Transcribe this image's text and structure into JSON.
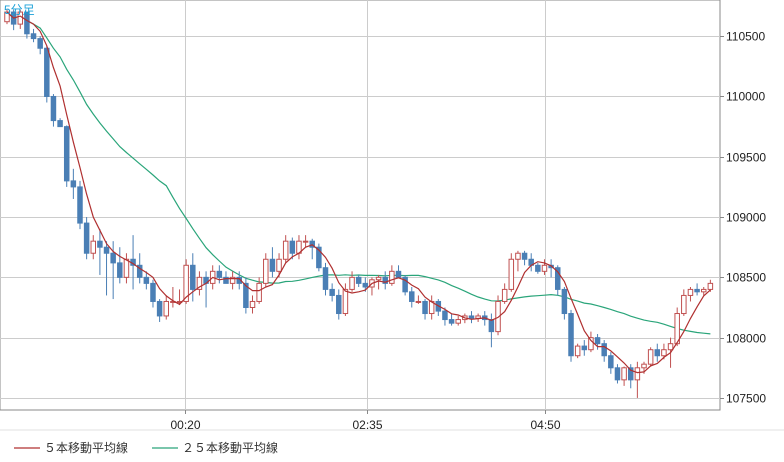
{
  "chart_data": {
    "type": "candlestick",
    "timeframe": "5分足",
    "x_ticks": [
      "00:20",
      "02:35",
      "04:50"
    ],
    "y_ticks": [
      107500,
      108000,
      108500,
      109000,
      109500,
      110000,
      110500
    ],
    "ylim": [
      107400,
      110800
    ],
    "grid": true,
    "legend_position": "bottom-left",
    "colors": {
      "up": "#ffffff",
      "up_border": "#c05050",
      "down": "#4a7fb5",
      "ma5": "#b03030",
      "ma25": "#2aa57a",
      "grid": "#cccccc",
      "timeframe_label": "#1aa0d8"
    },
    "series": [
      {
        "name": "５本移動平均線",
        "color": "#b03030"
      },
      {
        "name": "２５本移動平均線",
        "color": "#2aa57a"
      }
    ],
    "candles": [
      [
        110620,
        110720,
        110600,
        110700
      ],
      [
        110700,
        110720,
        110550,
        110600
      ],
      [
        110600,
        110720,
        110560,
        110700
      ],
      [
        110700,
        110700,
        110480,
        110520
      ],
      [
        110520,
        110560,
        110450,
        110480
      ],
      [
        110480,
        110500,
        110350,
        110400
      ],
      [
        110400,
        110420,
        109950,
        110000
      ],
      [
        110000,
        110020,
        109750,
        109800
      ],
      [
        109800,
        109820,
        109750,
        109750
      ],
      [
        109750,
        109760,
        109250,
        109300
      ],
      [
        109300,
        109400,
        109150,
        109250
      ],
      [
        109250,
        109300,
        108900,
        108950
      ],
      [
        108950,
        109000,
        108650,
        108700
      ],
      [
        108700,
        108850,
        108650,
        108800
      ],
      [
        108800,
        108900,
        108520,
        108750
      ],
      [
        108750,
        108800,
        108350,
        108700
      ],
      [
        108700,
        108800,
        108320,
        108620
      ],
      [
        108620,
        108750,
        108450,
        108500
      ],
      [
        108500,
        108700,
        108450,
        108650
      ],
      [
        108650,
        108850,
        108400,
        108600
      ],
      [
        108600,
        108700,
        108450,
        108500
      ],
      [
        108500,
        108550,
        108400,
        108450
      ],
      [
        108450,
        108480,
        108250,
        108300
      ],
      [
        108300,
        108320,
        108130,
        108180
      ],
      [
        108180,
        108350,
        108150,
        108300
      ],
      [
        108300,
        108420,
        108250,
        108300
      ],
      [
        108300,
        108400,
        108270,
        108300
      ],
      [
        108300,
        108650,
        108280,
        108600
      ],
      [
        108600,
        108700,
        108300,
        108400
      ],
      [
        108400,
        108550,
        108350,
        108500
      ],
      [
        108500,
        108550,
        108250,
        108450
      ],
      [
        108450,
        108600,
        108400,
        108550
      ],
      [
        108550,
        108600,
        108450,
        108500
      ],
      [
        108500,
        108550,
        108450,
        108450
      ],
      [
        108450,
        108550,
        108400,
        108500
      ],
      [
        108500,
        108550,
        108400,
        108450
      ],
      [
        108450,
        108500,
        108200,
        108250
      ],
      [
        108250,
        108350,
        108200,
        108300
      ],
      [
        108300,
        108500,
        108280,
        108450
      ],
      [
        108450,
        108700,
        108420,
        108650
      ],
      [
        108650,
        108750,
        108500,
        108550
      ],
      [
        108550,
        108700,
        108500,
        108650
      ],
      [
        108650,
        108850,
        108620,
        108800
      ],
      [
        108800,
        108830,
        108650,
        108700
      ],
      [
        108700,
        108850,
        108650,
        108800
      ],
      [
        108800,
        108850,
        108750,
        108800
      ],
      [
        108800,
        108820,
        108650,
        108750
      ],
      [
        108750,
        108780,
        108550,
        108580
      ],
      [
        108580,
        108620,
        108350,
        108400
      ],
      [
        108400,
        108450,
        108300,
        108350
      ],
      [
        108350,
        108400,
        108150,
        108200
      ],
      [
        108200,
        108450,
        108180,
        108400
      ],
      [
        108400,
        108550,
        108380,
        108500
      ],
      [
        108500,
        108520,
        108420,
        108450
      ],
      [
        108450,
        108500,
        108380,
        108420
      ],
      [
        108420,
        108500,
        108350,
        108480
      ],
      [
        108480,
        108520,
        108400,
        108500
      ],
      [
        108500,
        108550,
        108400,
        108450
      ],
      [
        108450,
        108600,
        108430,
        108550
      ],
      [
        108550,
        108600,
        108500,
        108500
      ],
      [
        108500,
        108520,
        108350,
        108380
      ],
      [
        108380,
        108420,
        108250,
        108300
      ],
      [
        108300,
        108350,
        108280,
        108300
      ],
      [
        108300,
        108320,
        108150,
        108200
      ],
      [
        108200,
        108350,
        108150,
        108300
      ],
      [
        108300,
        108320,
        108180,
        108220
      ],
      [
        108220,
        108250,
        108100,
        108150
      ],
      [
        108150,
        108200,
        108100,
        108120
      ],
      [
        108120,
        108180,
        108100,
        108150
      ],
      [
        108150,
        108200,
        108120,
        108180
      ],
      [
        108180,
        108220,
        108120,
        108160
      ],
      [
        108160,
        108200,
        108130,
        108180
      ],
      [
        108180,
        108220,
        108100,
        108150
      ],
      [
        108150,
        108200,
        107920,
        108050
      ],
      [
        108050,
        108350,
        108020,
        108300
      ],
      [
        108300,
        108450,
        108280,
        108400
      ],
      [
        108400,
        108700,
        108380,
        108650
      ],
      [
        108650,
        108720,
        108550,
        108700
      ],
      [
        108700,
        108720,
        108600,
        108650
      ],
      [
        108650,
        108700,
        108550,
        108600
      ],
      [
        108600,
        108620,
        108530,
        108550
      ],
      [
        108550,
        108650,
        108520,
        108600
      ],
      [
        108600,
        108650,
        108500,
        108580
      ],
      [
        108580,
        108600,
        108350,
        108400
      ],
      [
        108400,
        108420,
        108150,
        108200
      ],
      [
        108200,
        108230,
        107800,
        107850
      ],
      [
        107850,
        107950,
        107830,
        107930
      ],
      [
        107930,
        107980,
        107850,
        107900
      ],
      [
        107900,
        108050,
        107880,
        108000
      ],
      [
        108000,
        108030,
        107900,
        107950
      ],
      [
        107950,
        107980,
        107800,
        107850
      ],
      [
        107850,
        107880,
        107700,
        107750
      ],
      [
        107750,
        107780,
        107620,
        107650
      ],
      [
        107650,
        107760,
        107600,
        107750
      ],
      [
        107750,
        107780,
        107580,
        107650
      ],
      [
        107650,
        107800,
        107500,
        107750
      ],
      [
        107750,
        107800,
        107700,
        107780
      ],
      [
        107780,
        107920,
        107760,
        107900
      ],
      [
        107900,
        107950,
        107800,
        107850
      ],
      [
        107850,
        107950,
        107820,
        107900
      ],
      [
        107900,
        108000,
        107750,
        107950
      ],
      [
        107950,
        108250,
        107930,
        108200
      ],
      [
        108200,
        108400,
        108180,
        108350
      ],
      [
        108350,
        108420,
        108300,
        108400
      ],
      [
        108400,
        108450,
        108350,
        108380
      ],
      [
        108380,
        108420,
        108350,
        108400
      ],
      [
        108400,
        108480,
        108380,
        108450
      ]
    ]
  },
  "labels": {
    "timeframe": "5分足",
    "legend_ma5": "５本移動平均線",
    "legend_ma25": "２５本移動平均線"
  }
}
